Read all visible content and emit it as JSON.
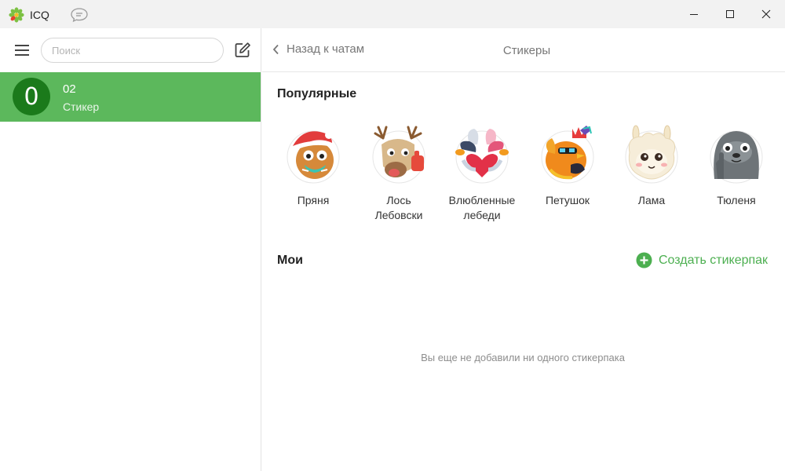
{
  "titlebar": {
    "app_title": "ICQ",
    "logo_icon": "icq-flower-icon",
    "chat_icon": "chat-bubble-icon",
    "min_icon": "minimize-icon",
    "max_icon": "maximize-icon",
    "close_icon": "close-icon"
  },
  "sidebar": {
    "menu_icon": "hamburger-menu-icon",
    "search_placeholder": "Поиск",
    "compose_icon": "compose-icon",
    "chats": [
      {
        "avatar_letter": "0",
        "name": "02",
        "preview": "Стикер",
        "selected": true
      }
    ]
  },
  "main": {
    "back_label": "Назад к чатам",
    "title": "Стикеры",
    "popular_title": "Популярные",
    "stickers": [
      {
        "label": "Пряня",
        "icon": "gingerbread-sticker"
      },
      {
        "label": "Лось\nЛебовски",
        "icon": "moose-sticker"
      },
      {
        "label": "Влюбленные\nлебеди",
        "icon": "swans-sticker"
      },
      {
        "label": "Петушок",
        "icon": "rooster-sticker"
      },
      {
        "label": "Лама",
        "icon": "llama-sticker"
      },
      {
        "label": "Тюленя",
        "icon": "seal-sticker"
      }
    ],
    "my_title": "Мои",
    "create_label": "Создать стикерпак",
    "empty_text": "Вы еще не добавили ни одного стикерпака"
  },
  "colors": {
    "accent_green": "#5cb85c",
    "create_green": "#4caf50",
    "avatar_green": "#1b7a1b",
    "titlebar_bg": "#f2f2f2"
  }
}
